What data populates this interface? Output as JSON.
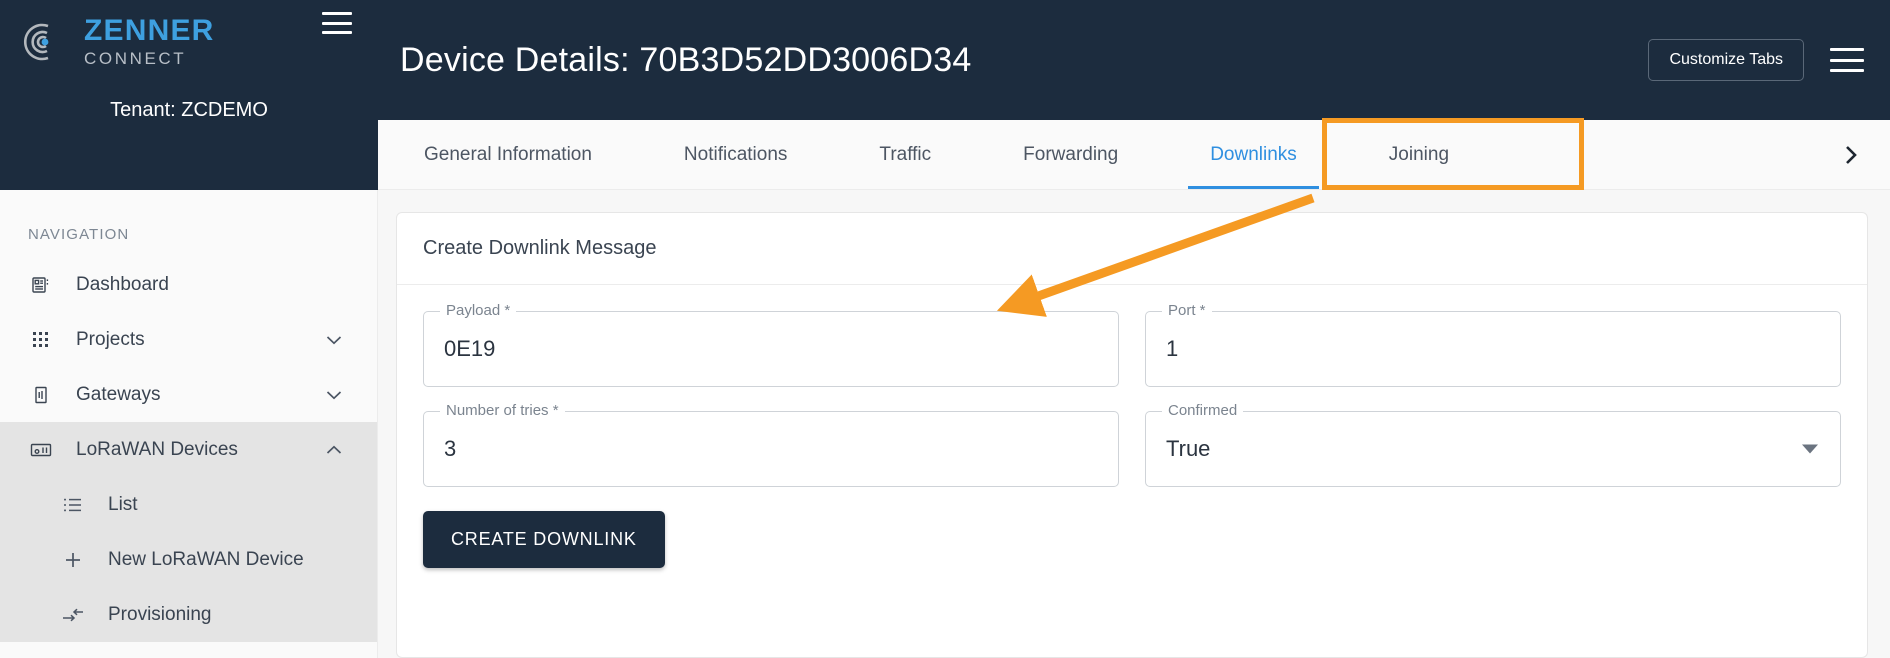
{
  "brand": {
    "name": "ZENNER",
    "subtitle": "CONNECT",
    "logo_icon": "zenner-radio-waves-logo",
    "burger_icon": "hamburger-menu-icon"
  },
  "sidebar": {
    "tenant": "Tenant: ZCDEMO",
    "nav_label": "NAVIGATION",
    "items": [
      {
        "label": "Dashboard",
        "icon": "dashboard-icon",
        "chevron": "",
        "active": false
      },
      {
        "label": "Projects",
        "icon": "grid-apps-icon",
        "chevron": "˅",
        "active": false
      },
      {
        "label": "Gateways",
        "icon": "gateway-icon",
        "chevron": "˅",
        "active": false
      },
      {
        "label": "LoRaWAN Devices",
        "icon": "device-chip-icon",
        "chevron": "˄",
        "active": true
      }
    ],
    "sub_items": [
      {
        "label": "List",
        "icon": "list-icon"
      },
      {
        "label": "New LoRaWAN Device",
        "icon": "plus-icon"
      },
      {
        "label": "Provisioning",
        "icon": "provisioning-arrow-icon"
      }
    ]
  },
  "header": {
    "title": "Device Details: 70B3D52DD3006D34",
    "customize_tabs_label": "Customize Tabs",
    "burger_icon": "hamburger-menu-icon"
  },
  "tabs": {
    "items": [
      {
        "label": "General Information",
        "active": false
      },
      {
        "label": "Notifications",
        "active": false
      },
      {
        "label": "Traffic",
        "active": false
      },
      {
        "label": "Forwarding",
        "active": false
      },
      {
        "label": "Downlinks",
        "active": true
      },
      {
        "label": "Joining",
        "active": false
      }
    ],
    "next_icon": "chevron-right-icon"
  },
  "card": {
    "title": "Create Downlink Message",
    "fields": [
      {
        "legend": "Payload *",
        "value": "0E19",
        "type": "text"
      },
      {
        "legend": "Port *",
        "value": "1",
        "type": "text"
      },
      {
        "legend": "Number of tries *",
        "value": "3",
        "type": "text"
      },
      {
        "legend": "Confirmed",
        "value": "True",
        "type": "select"
      }
    ],
    "submit_label": "CREATE DOWNLINK"
  },
  "annotation": {
    "highlight_color": "#f59a23",
    "arrow_from": "downlinks-tab",
    "arrow_to": "payload-field"
  },
  "colors": {
    "brand_blue": "#3ea0e0",
    "dark_navy": "#1c2c3e",
    "accent_orange": "#f59a23",
    "tab_active_blue": "#2f8fe0"
  }
}
